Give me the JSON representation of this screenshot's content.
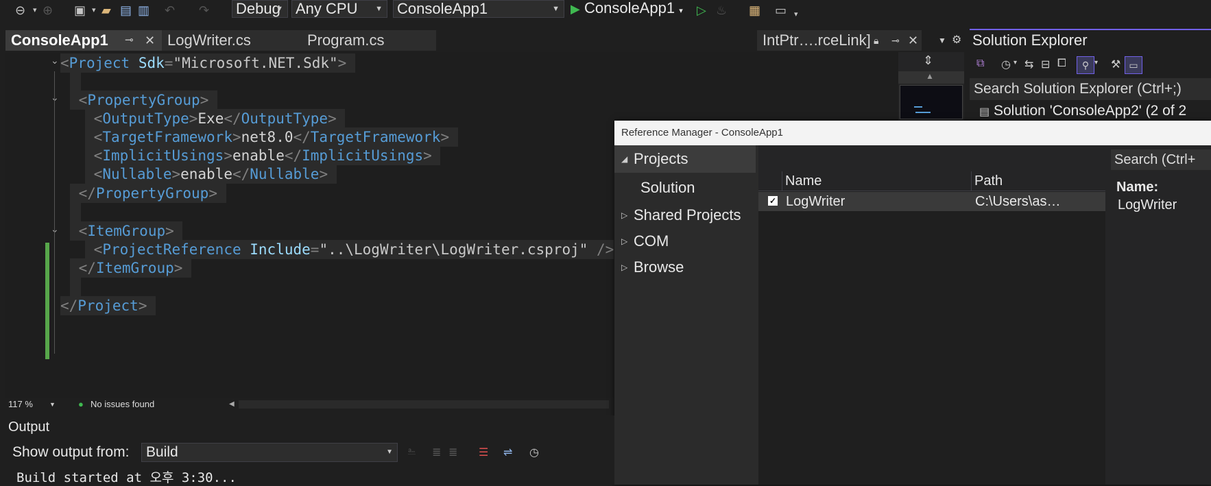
{
  "toolbar": {
    "config": "Debug",
    "platform": "Any CPU",
    "startup_project": "ConsoleApp1",
    "run_label": "ConsoleApp1"
  },
  "tabs": {
    "active": "ConsoleApp1",
    "logwriter": "LogWriter.cs",
    "program": "Program.cs",
    "intptr": "IntPtr….rceLink]"
  },
  "editor": {
    "lines": [
      {
        "tag": "Project",
        "attr": "Sdk",
        "value": "\"Microsoft.NET.Sdk\""
      },
      {
        "tag": "PropertyGroup"
      },
      {
        "tag": "OutputType",
        "text": "Exe"
      },
      {
        "tag": "TargetFramework",
        "text": "net8.0"
      },
      {
        "tag": "ImplicitUsings",
        "text": "enable"
      },
      {
        "tag": "Nullable",
        "text": "enable"
      },
      {
        "tag": "PropertyGroup",
        "closing": true
      },
      {
        "tag": "ItemGroup"
      },
      {
        "tag": "ProjectReference",
        "attr": "Include",
        "value": "\"..\\LogWriter\\LogWriter.csproj\""
      },
      {
        "tag": "ItemGroup",
        "closing": true
      },
      {
        "tag": "Project",
        "closing": true
      }
    ],
    "zoom": "117 %",
    "issues": "No issues found"
  },
  "solution_explorer": {
    "title": "Solution Explorer",
    "search_placeholder": "Search Solution Explorer (Ctrl+;)",
    "solution_node": "Solution 'ConsoleApp2' (2 of 2"
  },
  "reference_manager": {
    "title": "Reference Manager - ConsoleApp1",
    "nav": {
      "projects": "Projects",
      "solution": "Solution",
      "shared": "Shared Projects",
      "com": "COM",
      "browse": "Browse"
    },
    "columns": {
      "name": "Name",
      "path": "Path"
    },
    "rows": [
      {
        "name": "LogWriter",
        "path": "C:\\Users\\as…",
        "checked": true
      }
    ],
    "search_placeholder": "Search (Ctrl+",
    "details_label": "Name:",
    "details_value": "LogWriter"
  },
  "output": {
    "title": "Output",
    "show_from_label": "Show output from:",
    "source": "Build",
    "log_line": "Build started at 오후 3:30..."
  },
  "colors": {
    "accent": "#7160e8",
    "tag": "#569cd6",
    "attr": "#9cdcfe",
    "change_bar": "#57a64a"
  }
}
